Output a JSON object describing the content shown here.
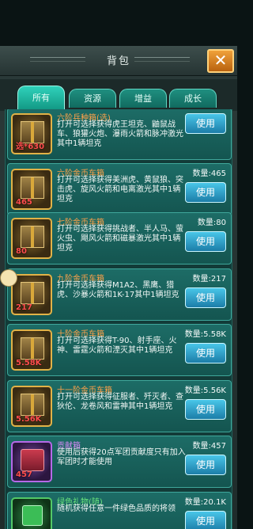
{
  "window": {
    "title": "背包",
    "close_icon": "close-icon"
  },
  "tabs": [
    {
      "label": "所有",
      "active": true
    },
    {
      "label": "资源",
      "active": false
    },
    {
      "label": "增益",
      "active": false
    },
    {
      "label": "成长",
      "active": false
    }
  ],
  "items": [
    {
      "name": "六阶兵种箱(选)",
      "desc": "打开可选择获得虎王坦克、鼬鼠战车、狼獾火炮、瀑雨火箭和脉冲激光其中1辆坦克",
      "qty": "",
      "count": "选*630",
      "use": "使用",
      "icon": "chest-icon",
      "rarity": "gold"
    },
    {
      "name": "六阶金币车箱",
      "desc": "打开可选择获得美洲虎、黄鼠狼、突击虎、旋风火箭和电离激光其中1辆坦克",
      "qty": "数量:465",
      "count": "465",
      "use": "使用",
      "icon": "chest-icon",
      "rarity": "gold"
    },
    {
      "name": "七阶金币车箱",
      "desc": "打开可选择获得挑战者、半人马、萤火虫、飓风火箭和磁暴激光其中1辆坦克",
      "qty": "数量:80",
      "count": "80",
      "use": "使用",
      "icon": "chest-icon",
      "rarity": "gold"
    },
    {
      "name": "九阶金币车箱",
      "desc": "打开可选择获得M1A2、黑鹰、猎虎、沙暴火箭和1K-17其中1辆坦克",
      "qty": "数量:217",
      "count": "217",
      "use": "使用",
      "icon": "chest-icon",
      "rarity": "gold"
    },
    {
      "name": "十阶金币车箱",
      "desc": "打开可选择获得T-90、射手座、火神、雷霆火箭和湮灭其中1辆坦克",
      "qty": "数量:5.58K",
      "count": "5.58K",
      "use": "使用",
      "icon": "chest-icon",
      "rarity": "gold"
    },
    {
      "name": "十一阶金币车箱",
      "desc": "打开可选择获得征服者、歼灭者、查狄伦、龙卷风和雷神其中1辆坦克",
      "qty": "数量:5.56K",
      "count": "5.56K",
      "use": "使用",
      "icon": "chest-icon",
      "rarity": "gold"
    },
    {
      "name": "贡献箱",
      "desc": "使用后获得20点军团贡献度只有加入军团时才能使用",
      "qty": "数量:457",
      "count": "457",
      "use": "使用",
      "icon": "crate-icon",
      "rarity": "purple"
    },
    {
      "name": "绿色礼物(随)",
      "desc": "随机获得任意一件绿色品质的将领",
      "qty": "数量:20.1K",
      "count": "",
      "use": "使用",
      "icon": "gift-icon",
      "rarity": "green"
    }
  ]
}
